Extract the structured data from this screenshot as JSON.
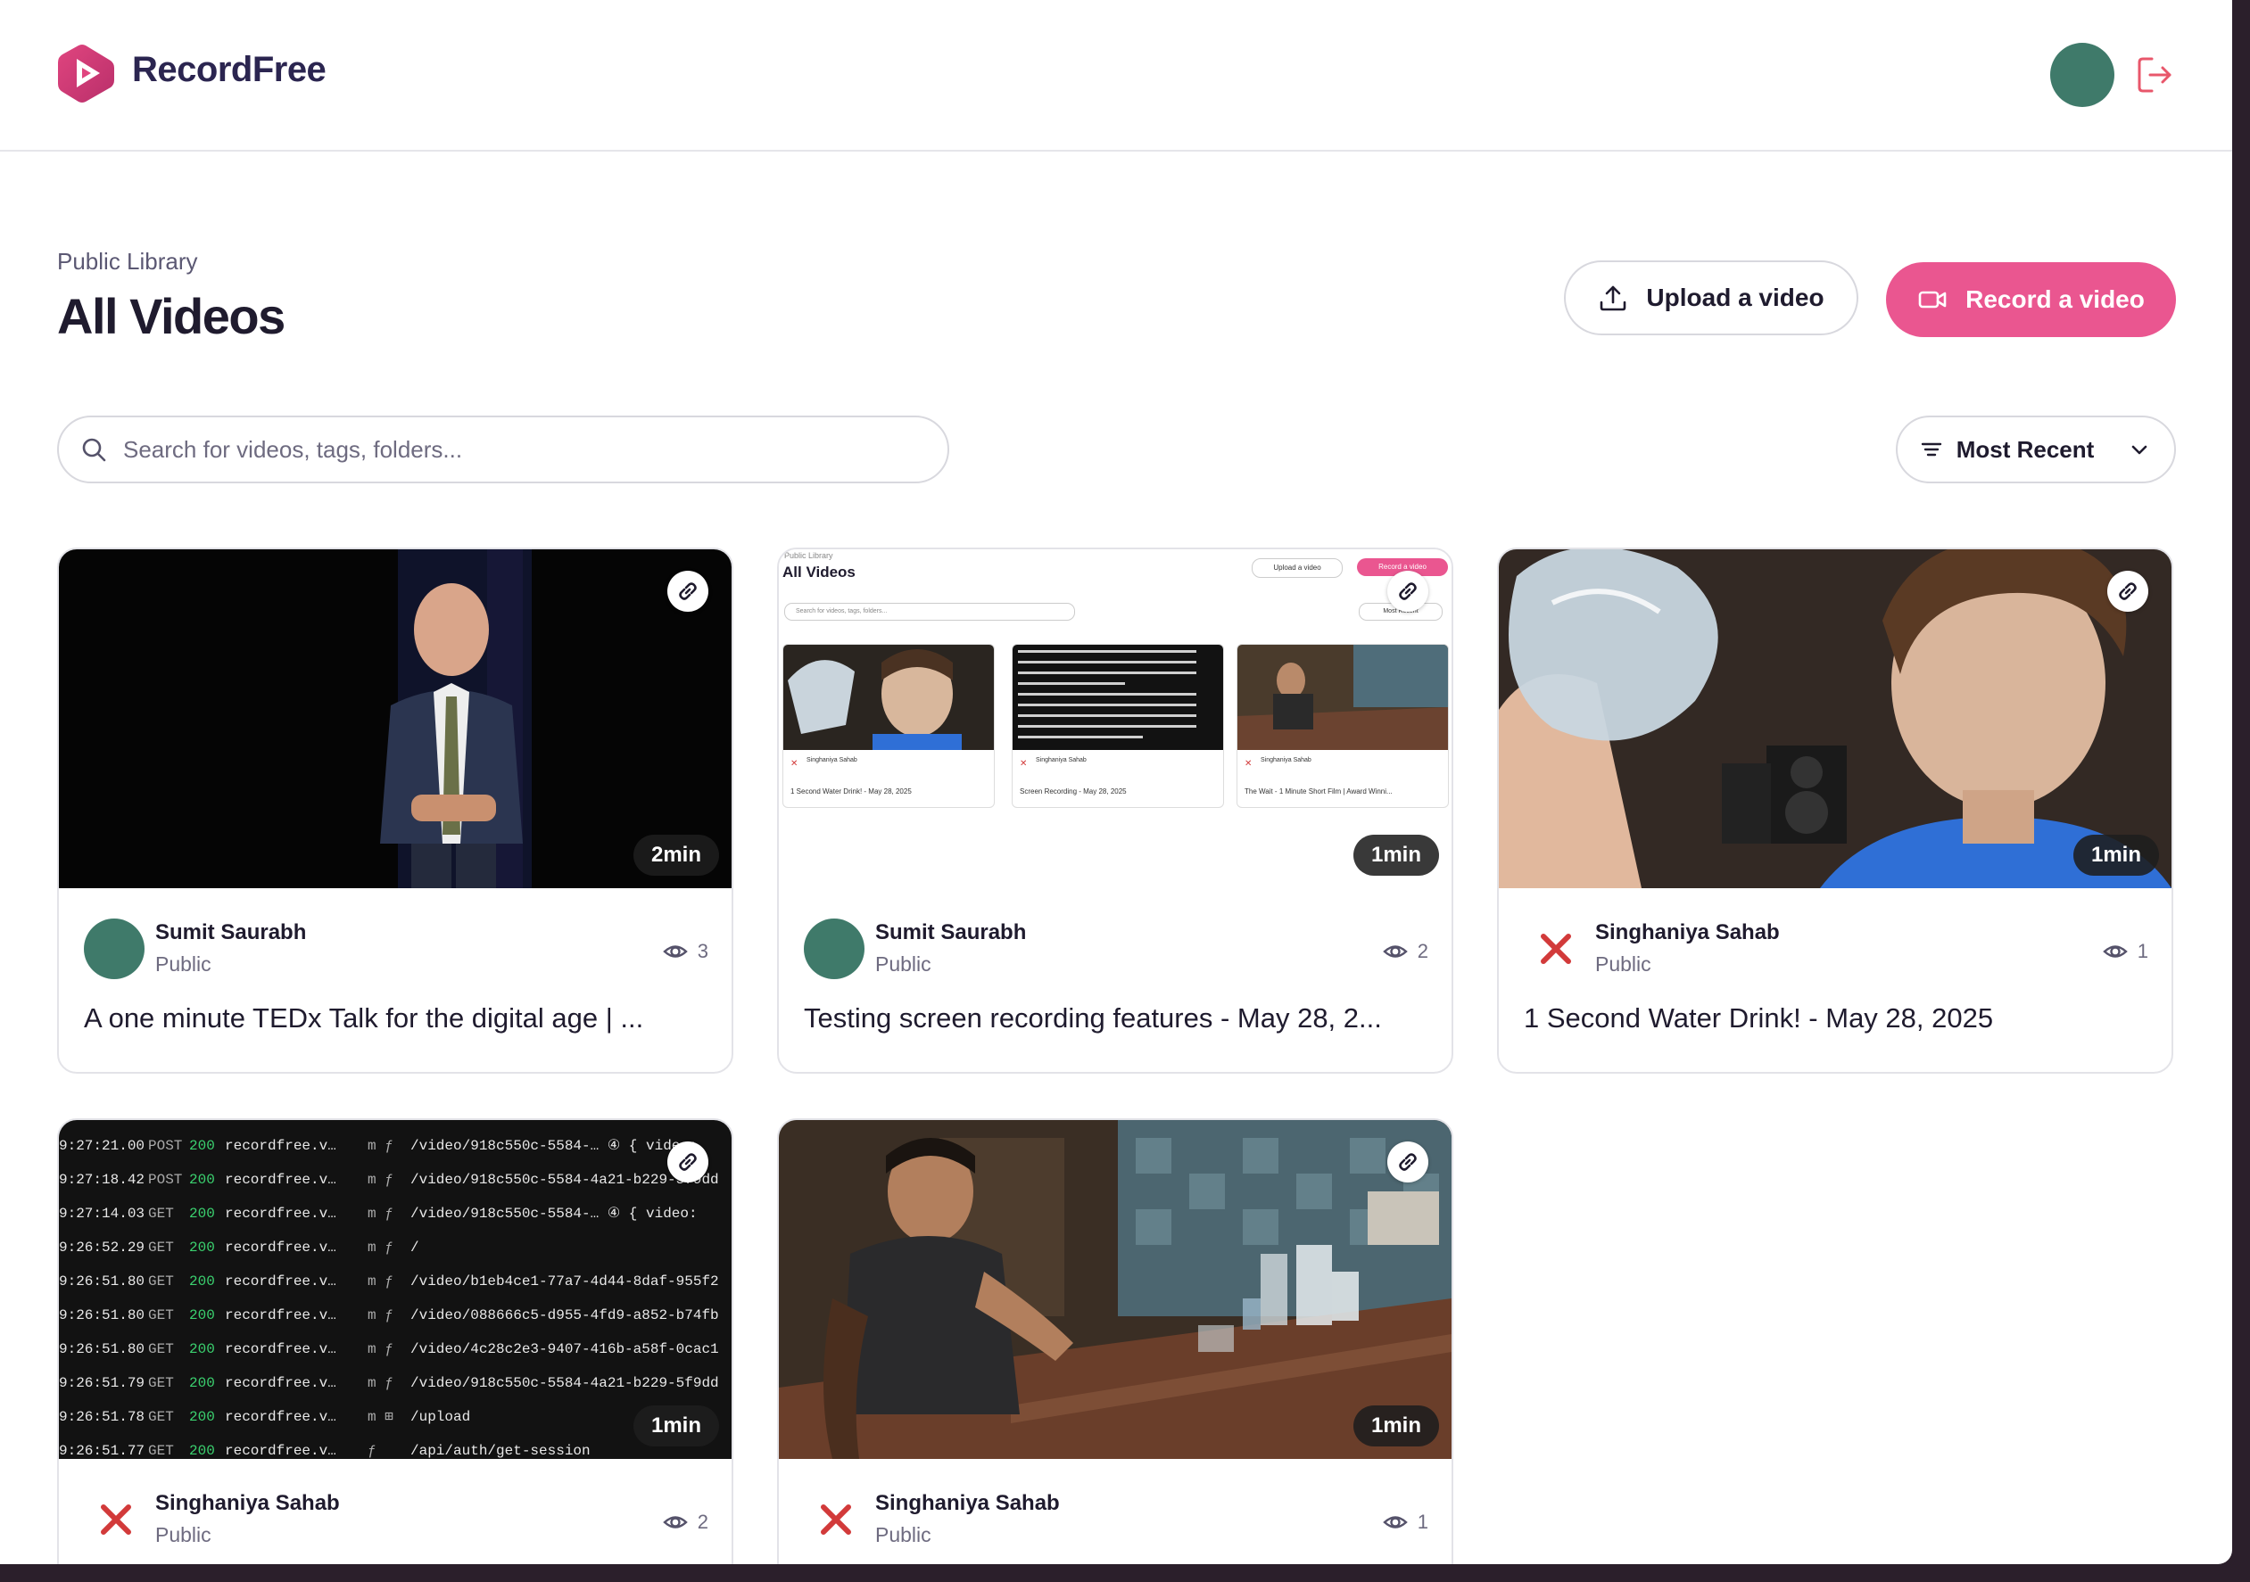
{
  "app": {
    "brand": "RecordFree"
  },
  "colors": {
    "accent": "#ea5690",
    "brand_text": "#2b2550",
    "avatar": "#3f7a6a",
    "unauthorized": "#d23a3a"
  },
  "header": {
    "eyebrow": "Public Library",
    "title": "All Videos"
  },
  "actions": {
    "upload_label": "Upload a video",
    "record_label": "Record a video"
  },
  "search": {
    "placeholder": "Search for videos, tags, folders..."
  },
  "sort": {
    "label": "Most Recent"
  },
  "videos": [
    {
      "author": "Sumit Saurabh",
      "visibility": "Public",
      "views": "3",
      "duration": "2min",
      "title": "A one minute TEDx Talk for the digital age | ...",
      "avatar": "avatar",
      "thumbnail": "stage-speaker"
    },
    {
      "author": "Sumit Saurabh",
      "visibility": "Public",
      "views": "2",
      "duration": "1min",
      "title": "Testing screen recording features - May 28, 2...",
      "avatar": "avatar",
      "thumbnail": "library-screenshot"
    },
    {
      "author": "Singhaniya Sahab",
      "visibility": "Public",
      "views": "1",
      "duration": "1min",
      "title": "1 Second Water Drink! - May 28, 2025",
      "avatar": "x-mark",
      "thumbnail": "water-bottle"
    },
    {
      "author": "Singhaniya Sahab",
      "visibility": "Public",
      "views": "2",
      "duration": "1min",
      "title": "",
      "avatar": "x-mark",
      "thumbnail": "terminal-log"
    },
    {
      "author": "Singhaniya Sahab",
      "visibility": "Public",
      "views": "1",
      "duration": "1min",
      "title": "",
      "avatar": "x-mark",
      "thumbnail": "man-at-table"
    }
  ],
  "terminal_log": [
    {
      "time": "9:27:21.00",
      "method": "POST",
      "status": "200",
      "host": "recordfree.v…",
      "icons": "m ƒ",
      "path": "/video/918c550c-5584-…  ④ { video:"
    },
    {
      "time": "9:27:18.42",
      "method": "POST",
      "status": "200",
      "host": "recordfree.v…",
      "icons": "m ƒ",
      "path": "/video/918c550c-5584-4a21-b229-5f9dd"
    },
    {
      "time": "9:27:14.03",
      "method": "GET",
      "status": "200",
      "host": "recordfree.v…",
      "icons": "m ƒ",
      "path": "/video/918c550c-5584-…  ④ { video:"
    },
    {
      "time": "9:26:52.29",
      "method": "GET",
      "status": "200",
      "host": "recordfree.v…",
      "icons": "m ƒ",
      "path": "/"
    },
    {
      "time": "9:26:51.80",
      "method": "GET",
      "status": "200",
      "host": "recordfree.v…",
      "icons": "m ƒ",
      "path": "/video/b1eb4ce1-77a7-4d44-8daf-955f2"
    },
    {
      "time": "9:26:51.80",
      "method": "GET",
      "status": "200",
      "host": "recordfree.v…",
      "icons": "m ƒ",
      "path": "/video/088666c5-d955-4fd9-a852-b74fb"
    },
    {
      "time": "9:26:51.80",
      "method": "GET",
      "status": "200",
      "host": "recordfree.v…",
      "icons": "m ƒ",
      "path": "/video/4c28c2e3-9407-416b-a58f-0cac1"
    },
    {
      "time": "9:26:51.79",
      "method": "GET",
      "status": "200",
      "host": "recordfree.v…",
      "icons": "m ƒ",
      "path": "/video/918c550c-5584-4a21-b229-5f9dd"
    },
    {
      "time": "9:26:51.78",
      "method": "GET",
      "status": "200",
      "host": "recordfree.v…",
      "icons": "m ⊞",
      "path": "/upload"
    },
    {
      "time": "9:26:51.77",
      "method": "GET",
      "status": "200",
      "host": "recordfree.v…",
      "icons": "  ƒ",
      "path": "/api/auth/get-session"
    }
  ],
  "mini_screenshot": {
    "eyebrow": "Public Library",
    "title": "All Videos",
    "upload_label": "Upload a video",
    "record_label": "Record a video",
    "search_placeholder": "Search for videos, tags, folders...",
    "sort_label": "Most Recent",
    "cards": [
      {
        "author": "Singhaniya Sahab",
        "title": "1 Second Water Drink! - May 28, 2025"
      },
      {
        "author": "Singhaniya Sahab",
        "title": "Screen Recording - May 28, 2025"
      },
      {
        "author": "Singhaniya Sahab",
        "title": "The Wait - 1 Minute Short Film | Award Winni..."
      }
    ]
  }
}
